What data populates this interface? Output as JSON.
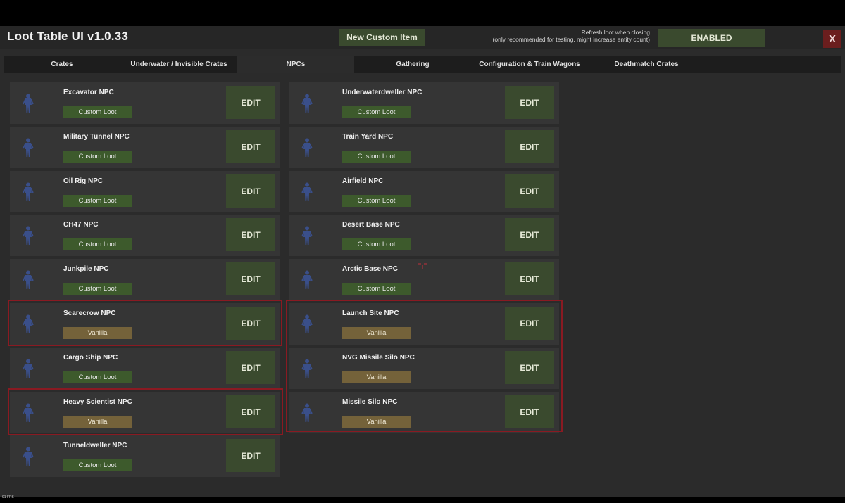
{
  "app": {
    "title": "Loot Table UI v1.0.33",
    "new_item_label": "New Custom Item",
    "refresh_note_line1": "Refresh loot when closing",
    "refresh_note_line2": "(only recommended for testing, might increase entity count)",
    "refresh_toggle_label": "ENABLED",
    "close_label": "X",
    "fps_label": "91 FPS"
  },
  "tabs": [
    {
      "label": "Crates",
      "active": false
    },
    {
      "label": "Underwater / Invisible Crates",
      "active": false
    },
    {
      "label": "NPCs",
      "active": true
    },
    {
      "label": "Gathering",
      "active": false
    },
    {
      "label": "Configuration & Train Wagons",
      "active": false
    },
    {
      "label": "Deathmatch Crates",
      "active": false
    }
  ],
  "npcs": [
    {
      "name": "Excavator NPC",
      "badge": "Custom Loot",
      "badge_type": "custom",
      "edit_label": "EDIT",
      "icon": "npc-figure-icon"
    },
    {
      "name": "Underwaterdweller NPC",
      "badge": "Custom Loot",
      "badge_type": "custom",
      "edit_label": "EDIT",
      "icon": "npc-figure-icon"
    },
    {
      "name": "Military Tunnel NPC",
      "badge": "Custom Loot",
      "badge_type": "custom",
      "edit_label": "EDIT",
      "icon": "npc-figure-icon"
    },
    {
      "name": "Train Yard NPC",
      "badge": "Custom Loot",
      "badge_type": "custom",
      "edit_label": "EDIT",
      "icon": "npc-figure-icon"
    },
    {
      "name": "Oil Rig NPC",
      "badge": "Custom Loot",
      "badge_type": "custom",
      "edit_label": "EDIT",
      "icon": "npc-figure-icon"
    },
    {
      "name": "Airfield NPC",
      "badge": "Custom Loot",
      "badge_type": "custom",
      "edit_label": "EDIT",
      "icon": "npc-figure-icon"
    },
    {
      "name": "CH47 NPC",
      "badge": "Custom Loot",
      "badge_type": "custom",
      "edit_label": "EDIT",
      "icon": "npc-figure-icon"
    },
    {
      "name": "Desert Base NPC",
      "badge": "Custom Loot",
      "badge_type": "custom",
      "edit_label": "EDIT",
      "icon": "npc-figure-icon"
    },
    {
      "name": "Junkpile NPC",
      "badge": "Custom Loot",
      "badge_type": "custom",
      "edit_label": "EDIT",
      "icon": "npc-figure-icon"
    },
    {
      "name": "Arctic Base NPC",
      "badge": "Custom Loot",
      "badge_type": "custom",
      "edit_label": "EDIT",
      "icon": "npc-figure-icon"
    },
    {
      "name": "Scarecrow NPC",
      "badge": "Vanilla",
      "badge_type": "vanilla",
      "edit_label": "EDIT",
      "icon": "npc-figure-icon"
    },
    {
      "name": "Launch Site NPC",
      "badge": "Vanilla",
      "badge_type": "vanilla",
      "edit_label": "EDIT",
      "icon": "npc-figure-icon"
    },
    {
      "name": "Cargo Ship NPC",
      "badge": "Custom Loot",
      "badge_type": "custom",
      "edit_label": "EDIT",
      "icon": "npc-figure-icon"
    },
    {
      "name": "NVG Missile Silo NPC",
      "badge": "Vanilla",
      "badge_type": "vanilla",
      "edit_label": "EDIT",
      "icon": "npc-figure-icon"
    },
    {
      "name": "Heavy Scientist NPC",
      "badge": "Vanilla",
      "badge_type": "vanilla",
      "edit_label": "EDIT",
      "icon": "npc-figure-icon"
    },
    {
      "name": "Missile Silo NPC",
      "badge": "Vanilla",
      "badge_type": "vanilla",
      "edit_label": "EDIT",
      "icon": "npc-figure-icon"
    },
    {
      "name": "Tunneldweller NPC",
      "badge": "Custom Loot",
      "badge_type": "custom",
      "edit_label": "EDIT",
      "icon": "npc-figure-icon"
    }
  ],
  "colors": {
    "background": "#2b2b2b",
    "card": "#353535",
    "button_green": "#3a4a2e",
    "badge_custom": "#3d5a2c",
    "badge_vanilla": "#74623a",
    "close_red": "#6b1e1e",
    "highlight_red": "#8a1a22",
    "npc_blue": "#3a4f8a"
  }
}
